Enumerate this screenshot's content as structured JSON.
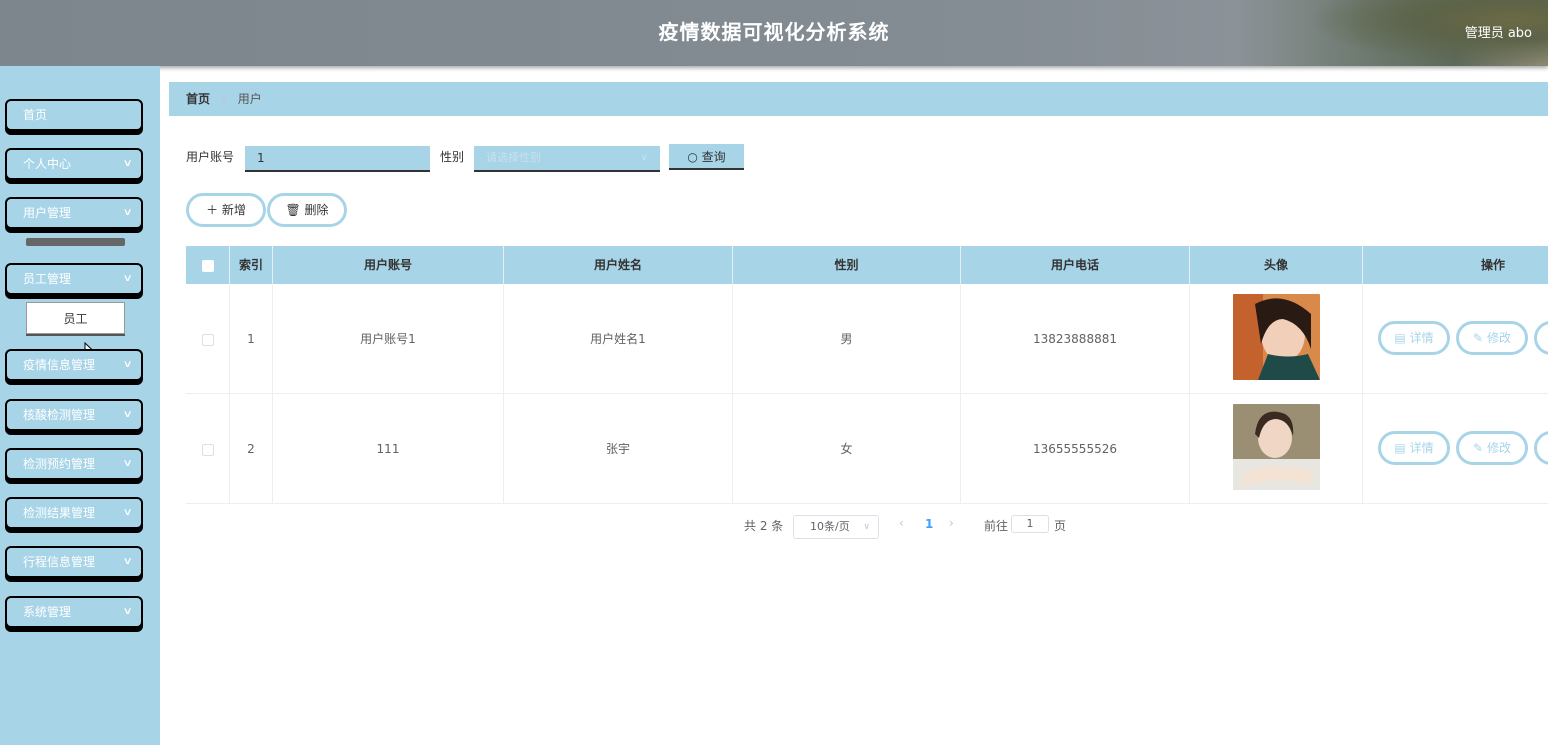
{
  "header": {
    "title": "疫情数据可视化分析系统",
    "user": "管理员 abo"
  },
  "sidebar": {
    "items": [
      {
        "label": "首页",
        "has_arrow": false
      },
      {
        "label": "个人中心",
        "has_arrow": true
      },
      {
        "label": "用户管理",
        "has_arrow": true
      },
      {
        "label": "员工管理",
        "has_arrow": true
      },
      {
        "label": "疫情信息管理",
        "has_arrow": true
      },
      {
        "label": "核酸检测管理",
        "has_arrow": true
      },
      {
        "label": "检测预约管理",
        "has_arrow": true
      },
      {
        "label": "检测结果管理",
        "has_arrow": true
      },
      {
        "label": "行程信息管理",
        "has_arrow": true
      },
      {
        "label": "系统管理",
        "has_arrow": true
      }
    ],
    "submenu_item": "员工"
  },
  "breadcrumb": {
    "home": "首页",
    "separator": "/",
    "current": "用户"
  },
  "search": {
    "account_label": "用户账号",
    "account_value": "1",
    "gender_label": "性别",
    "gender_placeholder": "请选择性别",
    "query_label": "查询"
  },
  "actions": {
    "add_label": "新增",
    "delete_label": "删除"
  },
  "table": {
    "headers": {
      "index": "索引",
      "account": "用户账号",
      "name": "用户姓名",
      "gender": "性别",
      "phone": "用户电话",
      "avatar": "头像",
      "ops": "操作"
    },
    "rows": [
      {
        "index": "1",
        "account": "用户账号1",
        "name": "用户姓名1",
        "gender": "男",
        "phone": "13823888881"
      },
      {
        "index": "2",
        "account": "111",
        "name": "张宇",
        "gender": "女",
        "phone": "13655555526"
      }
    ],
    "op_detail": "详情",
    "op_edit": "修改"
  },
  "pagination": {
    "total": "共 2 条",
    "page_size": "10条/页",
    "current_page": "1",
    "goto_label": "前往",
    "goto_value": "1",
    "page_suffix": "页"
  },
  "colors": {
    "accent": "#a8d4e8",
    "header": "#838b93",
    "page_active": "#409eff"
  }
}
